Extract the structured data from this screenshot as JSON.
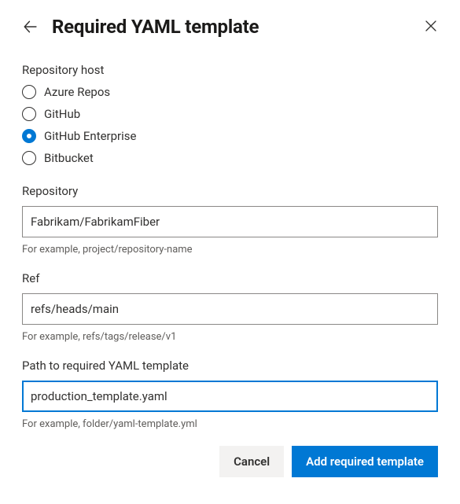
{
  "header": {
    "title": "Required YAML template"
  },
  "repository_host": {
    "label": "Repository host",
    "options": [
      {
        "label": "Azure Repos",
        "selected": false
      },
      {
        "label": "GitHub",
        "selected": false
      },
      {
        "label": "GitHub Enterprise",
        "selected": true
      },
      {
        "label": "Bitbucket",
        "selected": false
      }
    ]
  },
  "repository": {
    "label": "Repository",
    "value": "Fabrikam/FabrikamFiber",
    "hint": "For example, project/repository-name"
  },
  "ref": {
    "label": "Ref",
    "value": "refs/heads/main",
    "hint": "For example, refs/tags/release/v1"
  },
  "path": {
    "label": "Path to required YAML template",
    "value": "production_template.yaml",
    "hint": "For example, folder/yaml-template.yml"
  },
  "buttons": {
    "cancel": "Cancel",
    "submit": "Add required template"
  }
}
